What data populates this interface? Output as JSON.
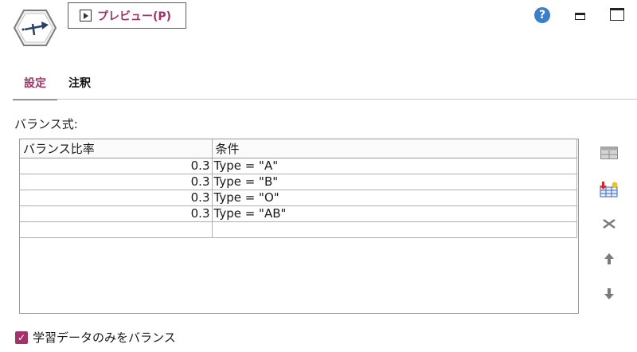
{
  "toolbar": {
    "preview_label": "プレビュー(P)",
    "help_glyph": "?"
  },
  "tabs": [
    {
      "label": "設定",
      "active": true
    },
    {
      "label": "注釈",
      "active": false
    }
  ],
  "section_label": "バランス式:",
  "table": {
    "columns": [
      "バランス比率",
      "条件"
    ],
    "rows": [
      [
        "0.3",
        "Type = \"A\""
      ],
      [
        "0.3",
        "Type = \"B\""
      ],
      [
        "0.3",
        "Type = \"O\""
      ],
      [
        "0.3",
        "Type = \"AB\""
      ],
      [
        "",
        ""
      ]
    ]
  },
  "side_tools": [
    "table-icon",
    "add-rows-icon",
    "delete-icon",
    "move-up-icon",
    "move-down-icon"
  ],
  "checkbox": {
    "label": "学習データのみをバランス",
    "checked": true
  },
  "colors": {
    "accent": "#a3326a",
    "help": "#3d7ec9"
  }
}
